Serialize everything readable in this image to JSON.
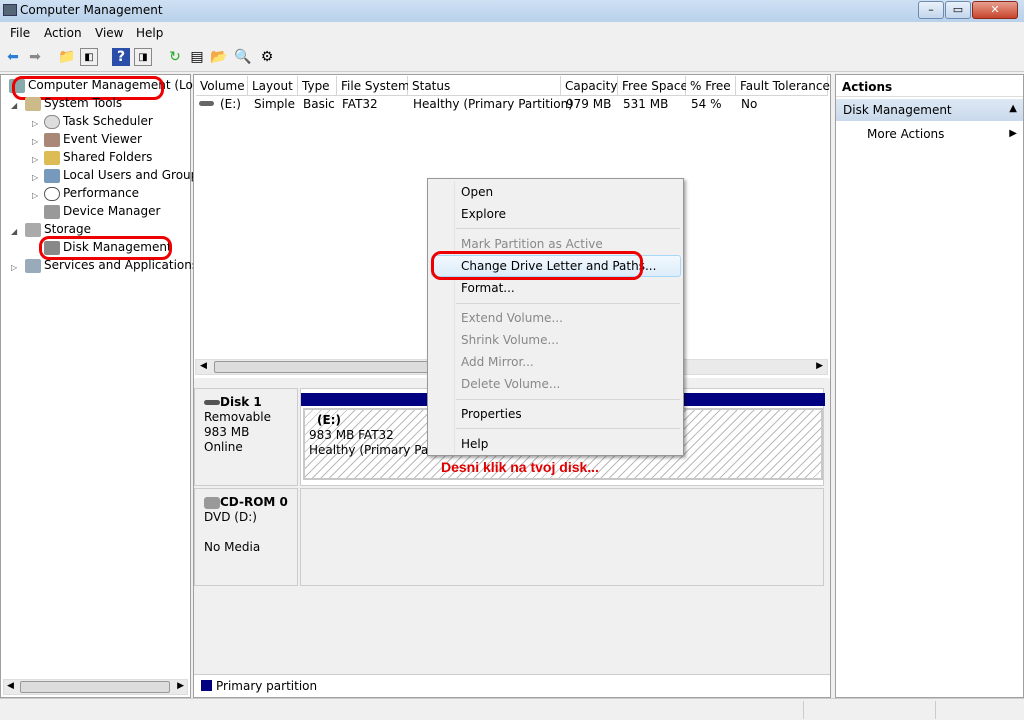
{
  "window": {
    "title": "Computer Management"
  },
  "menu": [
    "File",
    "Action",
    "View",
    "Help"
  ],
  "tree": {
    "root": "Computer Management (Local",
    "items": [
      {
        "label": "System Tools",
        "level": 1
      },
      {
        "label": "Task Scheduler",
        "level": 2
      },
      {
        "label": "Event Viewer",
        "level": 2
      },
      {
        "label": "Shared Folders",
        "level": 2
      },
      {
        "label": "Local Users and Groups",
        "level": 2
      },
      {
        "label": "Performance",
        "level": 2
      },
      {
        "label": "Device Manager",
        "level": 2
      },
      {
        "label": "Storage",
        "level": 1
      },
      {
        "label": "Disk Management",
        "level": 2
      },
      {
        "label": "Services and Applications",
        "level": 1
      }
    ]
  },
  "volumes": {
    "columns": [
      "Volume",
      "Layout",
      "Type",
      "File System",
      "Status",
      "Capacity",
      "Free Space",
      "% Free",
      "Fault Tolerance"
    ],
    "rows": [
      [
        "(E:)",
        "Simple",
        "Basic",
        "FAT32",
        "Healthy (Primary Partition)",
        "979 MB",
        "531 MB",
        "54 %",
        "No"
      ]
    ]
  },
  "disks": [
    {
      "name": "Disk 1",
      "type": "Removable",
      "size": "983 MB",
      "state": "Online",
      "partition": {
        "label": "(E:)",
        "fs": "983 MB FAT32",
        "status": "Healthy (Primary Partit"
      }
    },
    {
      "name": "CD-ROM 0",
      "type": "DVD (D:)",
      "state": "No Media"
    }
  ],
  "annotation": "Desni klik na tvoj disk...",
  "context_menu": [
    {
      "label": "Open",
      "enabled": true
    },
    {
      "label": "Explore",
      "enabled": true
    },
    {
      "label": "Mark Partition as Active",
      "enabled": false
    },
    {
      "label": "Change Drive Letter and Paths...",
      "enabled": true
    },
    {
      "label": "Format...",
      "enabled": true
    },
    {
      "label": "Extend Volume...",
      "enabled": false
    },
    {
      "label": "Shrink Volume...",
      "enabled": false
    },
    {
      "label": "Add Mirror...",
      "enabled": false
    },
    {
      "label": "Delete Volume...",
      "enabled": false
    },
    {
      "label": "Properties",
      "enabled": true
    },
    {
      "label": "Help",
      "enabled": true
    }
  ],
  "actions": {
    "title": "Actions",
    "section": "Disk Management",
    "more": "More Actions"
  },
  "legend": "Primary partition",
  "colors": {
    "primary": "#000080",
    "highlight": "#e00000"
  }
}
